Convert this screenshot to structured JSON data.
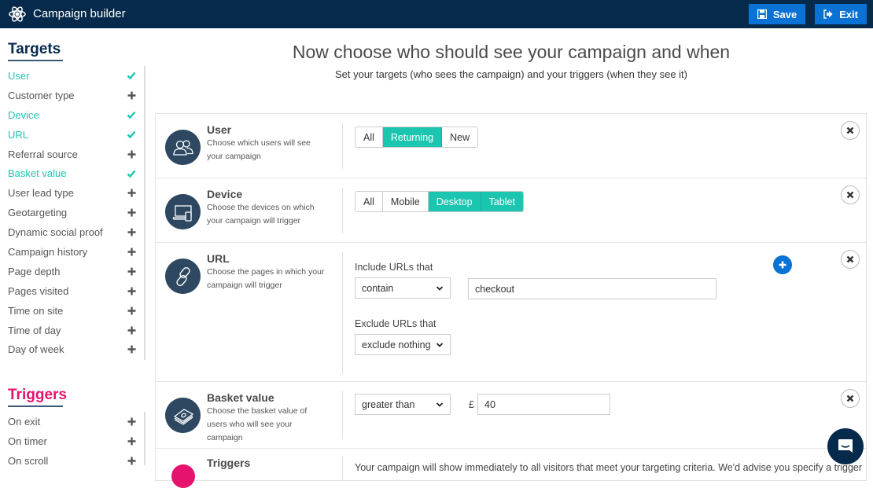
{
  "header": {
    "app_title": "Campaign builder",
    "save_label": "Save",
    "exit_label": "Exit"
  },
  "sidebar": {
    "targets_title": "Targets",
    "targets": [
      {
        "label": "User",
        "state": "checked"
      },
      {
        "label": "Customer type",
        "state": "add"
      },
      {
        "label": "Device",
        "state": "checked"
      },
      {
        "label": "URL",
        "state": "checked"
      },
      {
        "label": "Referral source",
        "state": "add"
      },
      {
        "label": "Basket value",
        "state": "checked"
      },
      {
        "label": "User lead type",
        "state": "add"
      },
      {
        "label": "Geotargeting",
        "state": "add"
      },
      {
        "label": "Dynamic social proof",
        "state": "add"
      },
      {
        "label": "Campaign history",
        "state": "add"
      },
      {
        "label": "Page depth",
        "state": "add"
      },
      {
        "label": "Pages visited",
        "state": "add"
      },
      {
        "label": "Time on site",
        "state": "add"
      },
      {
        "label": "Time of day",
        "state": "add"
      },
      {
        "label": "Day of week",
        "state": "add"
      }
    ],
    "triggers_title": "Triggers",
    "triggers": [
      {
        "label": "On exit",
        "state": "add"
      },
      {
        "label": "On timer",
        "state": "add"
      },
      {
        "label": "On scroll",
        "state": "add"
      }
    ]
  },
  "main": {
    "title": "Now choose who should see your campaign and when",
    "subtitle": "Set your targets (who sees the campaign) and your triggers (when they see it)",
    "user": {
      "title": "User",
      "desc": "Choose which users will see your campaign",
      "options": [
        "All",
        "Returning",
        "New"
      ],
      "selected": [
        "Returning"
      ]
    },
    "device": {
      "title": "Device",
      "desc": "Choose the devices on which your campaign will trigger",
      "options": [
        "All",
        "Mobile",
        "Desktop",
        "Tablet"
      ],
      "selected": [
        "Desktop",
        "Tablet"
      ]
    },
    "url": {
      "title": "URL",
      "desc": "Choose the pages in which your campaign will trigger",
      "include_label": "Include URLs that",
      "include_match": "contain",
      "include_value": "checkout",
      "exclude_label": "Exclude URLs that",
      "exclude_match": "exclude nothing"
    },
    "basket": {
      "title": "Basket value",
      "desc": "Choose the basket value of users who will see your campaign",
      "comparator": "greater than",
      "currency": "£",
      "value": "40"
    },
    "triggers": {
      "title": "Triggers",
      "text": "Your campaign will show immediately to all visitors that meet your targeting criteria. We'd advise you specify a trigger"
    }
  },
  "colors": {
    "topbar": "#062a4b",
    "primary_button": "#0a72d4",
    "accent_teal": "#1bc5b0",
    "triggers_pink": "#e6136e",
    "icon_circle": "#2d4860"
  }
}
